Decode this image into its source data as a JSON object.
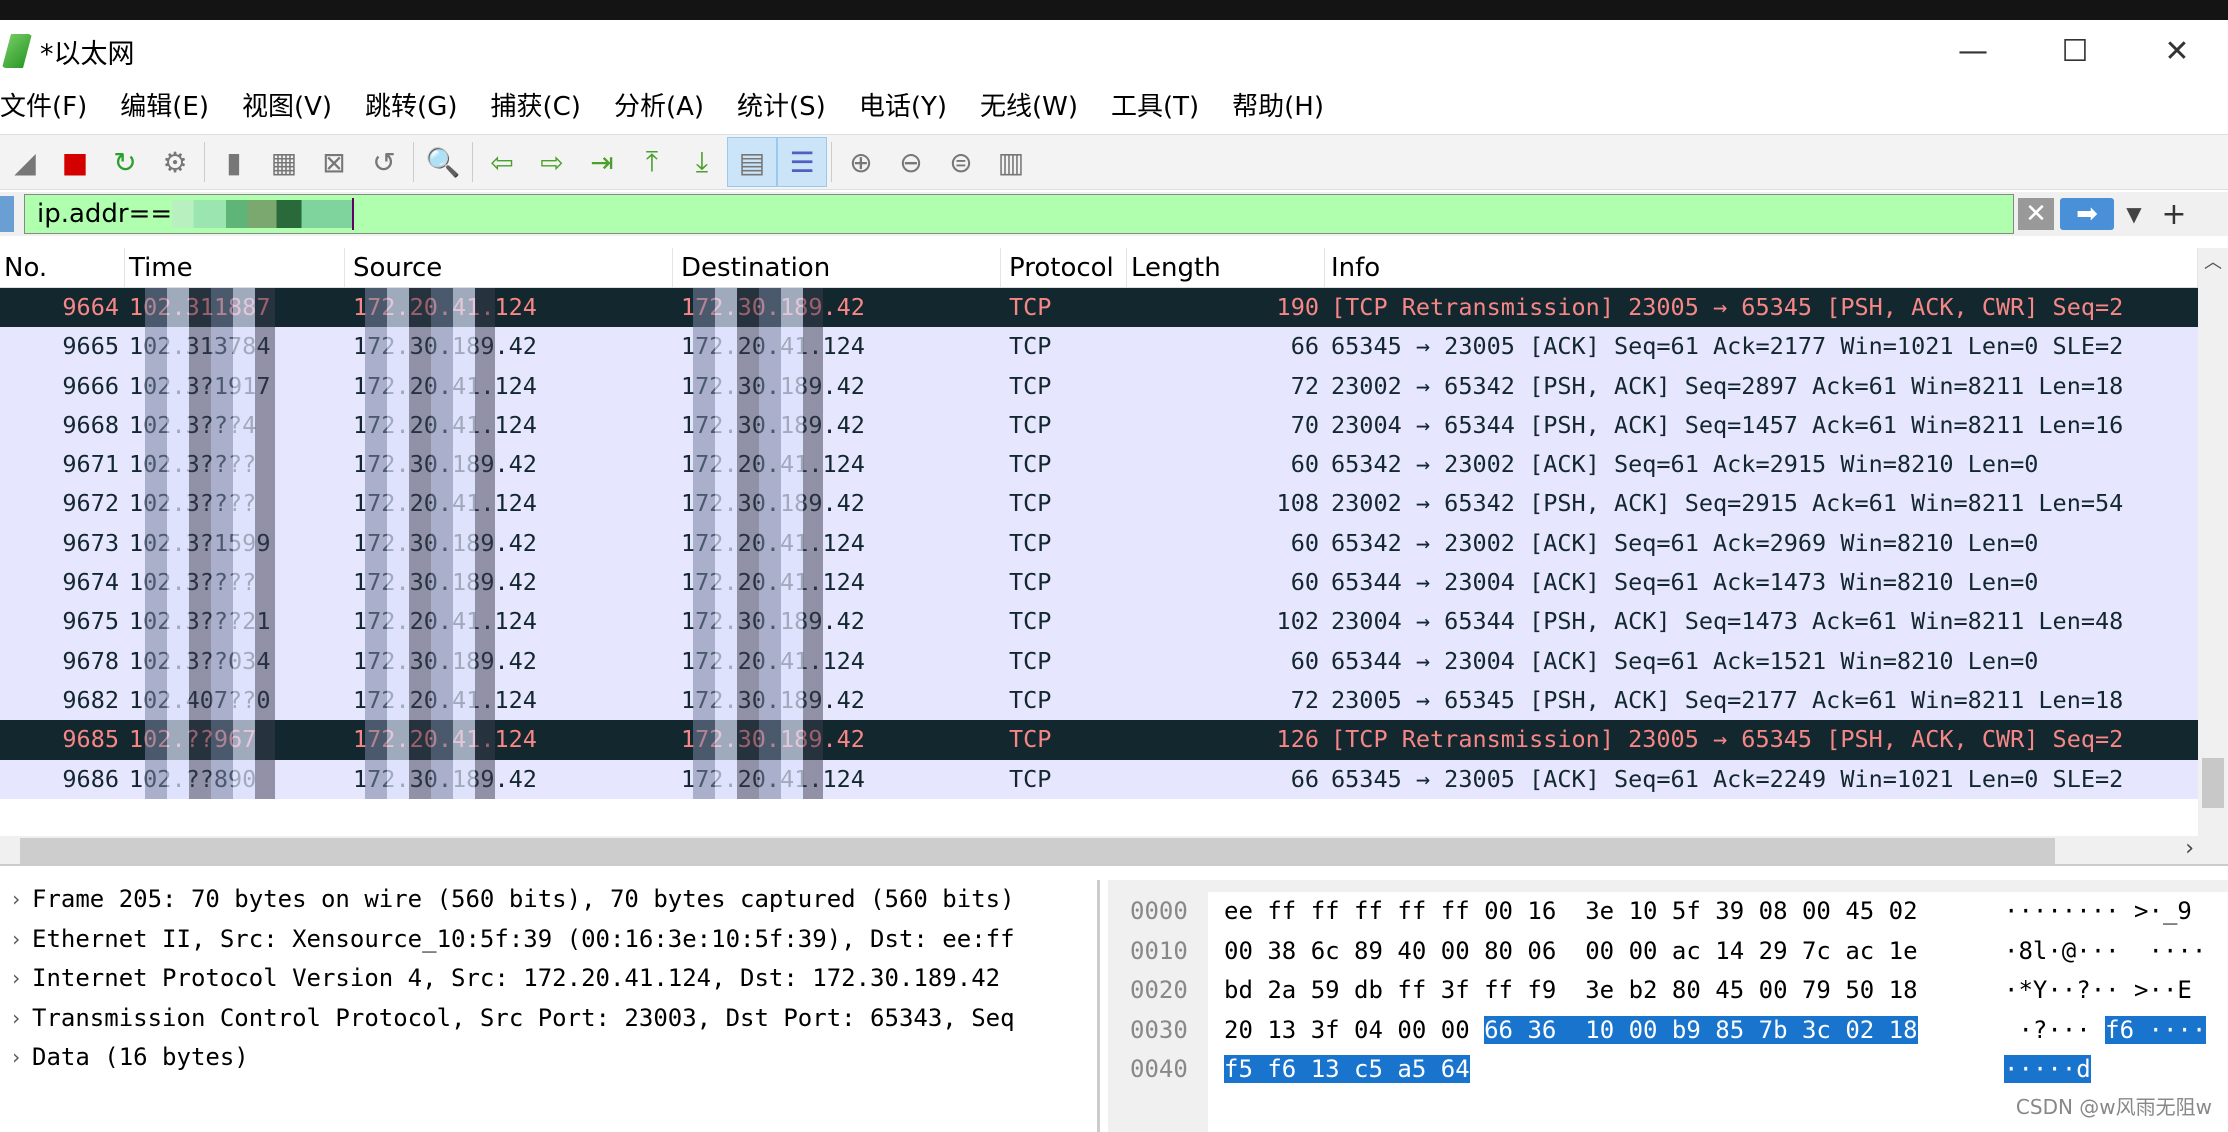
{
  "window": {
    "title": "*以太网",
    "minimize": "—",
    "maximize": "☐",
    "close": "✕"
  },
  "menu": [
    "文件(F)",
    "编辑(E)",
    "视图(V)",
    "跳转(G)",
    "捕获(C)",
    "分析(A)",
    "统计(S)",
    "电话(Y)",
    "无线(W)",
    "工具(T)",
    "帮助(H)"
  ],
  "toolbar": [
    "shark-fin-start-icon",
    "stop-capture-icon",
    "restart-capture-icon",
    "capture-options-icon",
    "open-file-icon",
    "save-file-icon",
    "close-file-icon",
    "reload-file-icon",
    "find-packet-icon",
    "go-back-icon",
    "go-forward-icon",
    "go-to-packet-icon",
    "first-packet-icon",
    "last-packet-icon",
    "autoscroll-icon",
    "colorize-icon",
    "zoom-in-icon",
    "zoom-out-icon",
    "normal-size-icon",
    "resize-columns-icon"
  ],
  "filter": {
    "value": "ip.addr==",
    "plus": "+"
  },
  "columns": {
    "no": "No.",
    "time": "Time",
    "source": "Source",
    "destination": "Destination",
    "protocol": "Protocol",
    "length": "Length",
    "info": "Info"
  },
  "packets": [
    {
      "no": "9664",
      "time": "102.311887",
      "src": "172.20.41.124",
      "dst": "172.30.189.42",
      "proto": "TCP",
      "len": "190",
      "info": "[TCP Retransmission] 23005 → 65345 [PSH, ACK, CWR] Seq=2",
      "bad": true
    },
    {
      "no": "9665",
      "time": "102.313784",
      "src": "172.30.189.42",
      "dst": "172.20.41.124",
      "proto": "TCP",
      "len": "66",
      "info": "65345 → 23005 [ACK] Seq=61 Ack=2177 Win=1021 Len=0 SLE=2"
    },
    {
      "no": "9666",
      "time": "102.3?1917",
      "src": "172.20.41.124",
      "dst": "172.30.189.42",
      "proto": "TCP",
      "len": "72",
      "info": "23002 → 65342 [PSH, ACK] Seq=2897 Ack=61 Win=8211 Len=18"
    },
    {
      "no": "9668",
      "time": "102.3???4",
      "src": "172.20.41.124",
      "dst": "172.30.189.42",
      "proto": "TCP",
      "len": "70",
      "info": "23004 → 65344 [PSH, ACK] Seq=1457 Ack=61 Win=8211 Len=16"
    },
    {
      "no": "9671",
      "time": "102.3????",
      "src": "172.30.189.42",
      "dst": "172.20.41.124",
      "proto": "TCP",
      "len": "60",
      "info": "65342 → 23002 [ACK] Seq=61 Ack=2915 Win=8210 Len=0"
    },
    {
      "no": "9672",
      "time": "102.3????",
      "src": "172.20.41.124",
      "dst": "172.30.189.42",
      "proto": "TCP",
      "len": "108",
      "info": "23002 → 65342 [PSH, ACK] Seq=2915 Ack=61 Win=8211 Len=54"
    },
    {
      "no": "9673",
      "time": "102.3?1599",
      "src": "172.30.189.42",
      "dst": "172.20.41.124",
      "proto": "TCP",
      "len": "60",
      "info": "65342 → 23002 [ACK] Seq=61 Ack=2969 Win=8210 Len=0"
    },
    {
      "no": "9674",
      "time": "102.3????",
      "src": "172.30.189.42",
      "dst": "172.20.41.124",
      "proto": "TCP",
      "len": "60",
      "info": "65344 → 23004 [ACK] Seq=61 Ack=1473 Win=8210 Len=0"
    },
    {
      "no": "9675",
      "time": "102.3???21",
      "src": "172.20.41.124",
      "dst": "172.30.189.42",
      "proto": "TCP",
      "len": "102",
      "info": "23004 → 65344 [PSH, ACK] Seq=1473 Ack=61 Win=8211 Len=48"
    },
    {
      "no": "9678",
      "time": "102.3??034",
      "src": "172.30.189.42",
      "dst": "172.20.41.124",
      "proto": "TCP",
      "len": "60",
      "info": "65344 → 23004 [ACK] Seq=61 Ack=1521 Win=8210 Len=0"
    },
    {
      "no": "9682",
      "time": "102.407??0",
      "src": "172.20.41.124",
      "dst": "172.30.189.42",
      "proto": "TCP",
      "len": "72",
      "info": "23005 → 65345 [PSH, ACK] Seq=2177 Ack=61 Win=8211 Len=18"
    },
    {
      "no": "9685",
      "time": "102.??967",
      "src": "172.20.41.124",
      "dst": "172.30.189.42",
      "proto": "TCP",
      "len": "126",
      "info": "[TCP Retransmission] 23005 → 65345 [PSH, ACK, CWR] Seq=2",
      "bad": true
    },
    {
      "no": "9686",
      "time": "102.??890",
      "src": "172.30.189.42",
      "dst": "172.20.41.124",
      "proto": "TCP",
      "len": "66",
      "info": "65345 → 23005 [ACK] Seq=61 Ack=2249 Win=1021 Len=0 SLE=2"
    }
  ],
  "details": [
    "Frame 205: 70 bytes on wire (560 bits), 70 bytes captured (560 bits)",
    "Ethernet II, Src: Xensource_10:5f:39 (00:16:3e:10:5f:39), Dst: ee:ff",
    "Internet Protocol Version 4, Src: 172.20.41.124, Dst: 172.30.189.42",
    "Transmission Control Protocol, Src Port: 23003, Dst Port: 65343, Seq",
    "Data (16 bytes)"
  ],
  "hex": [
    {
      "off": "0000",
      "bytes": "ee ff ff ff ff ff 00 16  3e 10 5f 39 08 00 45 02",
      "sel": "",
      "ascii": "········ >·_9",
      "asel": ""
    },
    {
      "off": "0010",
      "bytes": "00 38 6c 89 40 00 80 06  00 00 ac 14 29 7c ac 1e",
      "sel": "",
      "ascii": "·8l·@···  ····",
      "asel": ""
    },
    {
      "off": "0020",
      "bytes": "bd 2a 59 db ff 3f ff f9  3e b2 80 45 00 79 50 18",
      "sel": "",
      "ascii": "·*Y··?·· >··E",
      "asel": ""
    },
    {
      "off": "0030",
      "bytes": "20 13 3f 04 00 00 ",
      "sel": "66 36  10 00 b9 85 7b 3c 02 18",
      "ascii": " ·?··· ",
      "asel": "f6 ····"
    },
    {
      "off": "0040",
      "bytes": "",
      "sel": "f5 f6 13 c5 a5 64",
      "ascii": "",
      "asel": "·····d"
    }
  ],
  "watermark": "CSDN @w风雨无阻w"
}
